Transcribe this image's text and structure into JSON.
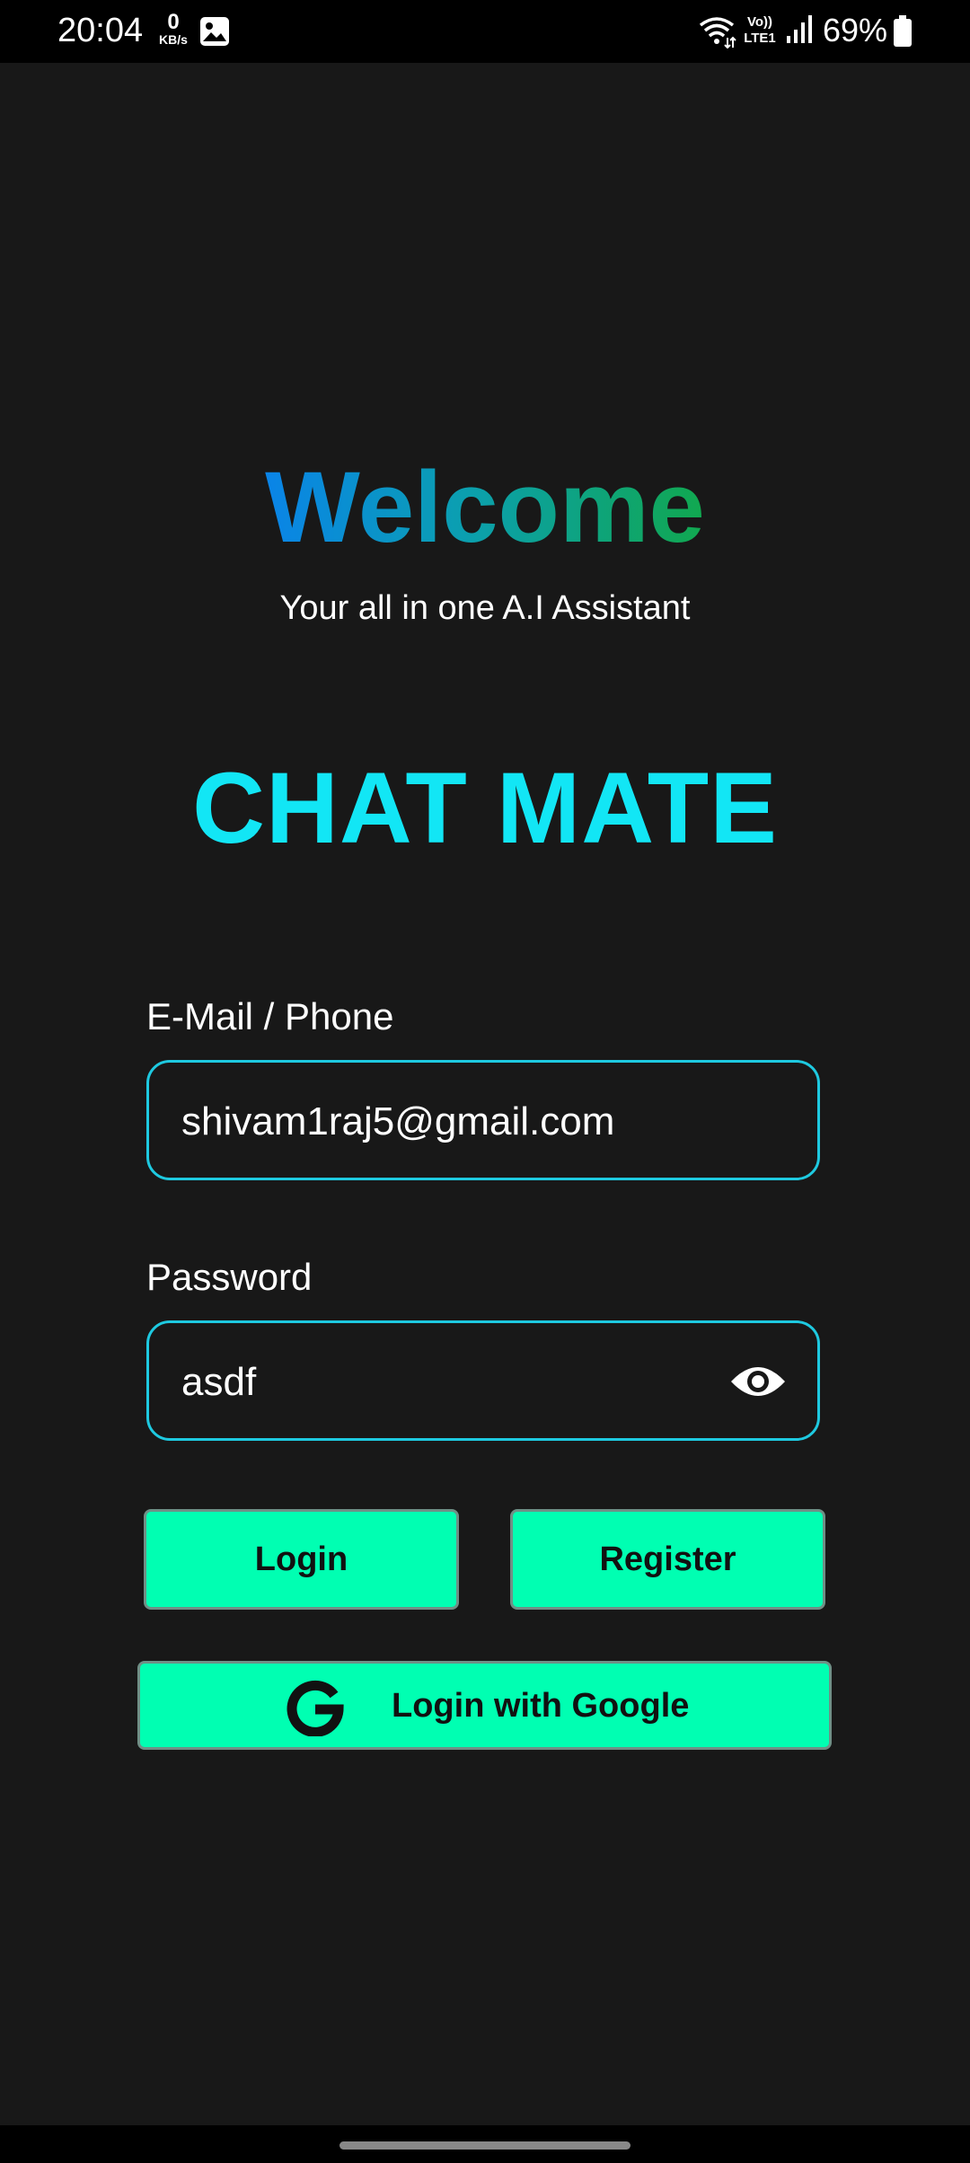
{
  "status_bar": {
    "time": "20:04",
    "net_speed_value": "0",
    "net_speed_unit": "KB/s",
    "volte_top": "Vo))",
    "volte_bottom": "LTE1",
    "battery": "69%",
    "icons": [
      "gallery-icon",
      "wifi-icon",
      "signal-icon",
      "battery-icon"
    ]
  },
  "header": {
    "welcome": "Welcome",
    "subtitle": "Your all in one A.I Assistant",
    "app_name": "CHAT MATE"
  },
  "form": {
    "email_label": "E-Mail / Phone",
    "email_value": "shivam1raj5@gmail.com",
    "password_label": "Password",
    "password_value": "asdf"
  },
  "buttons": {
    "login": "Login",
    "register": "Register",
    "google": "Login with Google"
  },
  "colors": {
    "background": "#181818",
    "accent_cyan": "#12e6f5",
    "button_green": "#00ffb2",
    "field_border": "#1ec9e0"
  }
}
